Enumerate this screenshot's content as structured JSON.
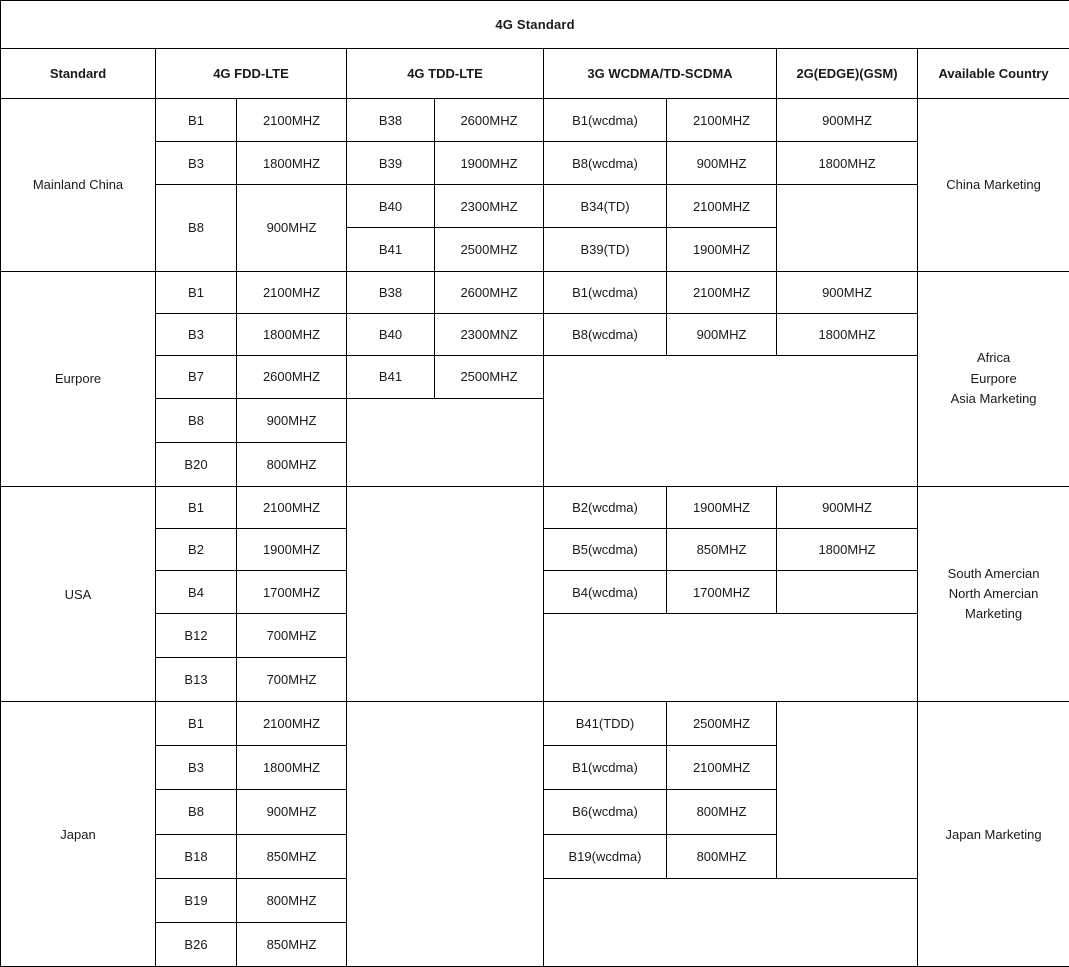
{
  "title": "4G Standard",
  "columns": {
    "standard": "Standard",
    "fdd_lte": "4G FDD-LTE",
    "tdd_lte": "4G TDD-LTE",
    "wcdma": "3G WCDMA/TD-SCDMA",
    "gsm": "2G(EDGE)(GSM)",
    "country": "Available Country"
  },
  "colors": {
    "accent": "#E8502A",
    "text": "#1a1a1a",
    "border": "#000000",
    "background": "#ffffff"
  },
  "sections": [
    {
      "name": "Mainland China",
      "market": "China Marketing",
      "fdd": [
        {
          "band": "B1",
          "freq": "2100MHZ"
        },
        {
          "band": "B3",
          "freq": "1800MHZ"
        },
        {
          "band": "B8",
          "freq": "900MHZ"
        }
      ],
      "tdd": [
        {
          "band": "B38",
          "freq": "2600MHZ"
        },
        {
          "band": "B39",
          "freq": "1900MHZ"
        },
        {
          "band": "B40",
          "freq": "2300MHZ"
        },
        {
          "band": "B41",
          "freq": "2500MHZ"
        }
      ],
      "wcdma": [
        {
          "band": "B1(wcdma)",
          "freq": "2100MHZ"
        },
        {
          "band": "B8(wcdma)",
          "freq": "900MHZ"
        },
        {
          "band": "B34(TD)",
          "freq": "2100MHZ"
        },
        {
          "band": "B39(TD)",
          "freq": "1900MHZ"
        }
      ],
      "gsm": [
        "900MHZ",
        "1800MHZ"
      ]
    },
    {
      "name": "Eurpore",
      "market": "Africa\nEurpore\nAsia Marketing",
      "market_lines": [
        "Africa",
        "Eurpore",
        "Asia Marketing"
      ],
      "fdd": [
        {
          "band": "B1",
          "freq": "2100MHZ"
        },
        {
          "band": "B3",
          "freq": "1800MHZ"
        },
        {
          "band": "B7",
          "freq": "2600MHZ"
        },
        {
          "band": "B8",
          "freq": "900MHZ"
        },
        {
          "band": "B20",
          "freq": "800MHZ"
        }
      ],
      "tdd": [
        {
          "band": "B38",
          "freq": "2600MHZ"
        },
        {
          "band": "B40",
          "freq": "2300MNZ"
        },
        {
          "band": "B41",
          "freq": "2500MHZ"
        }
      ],
      "wcdma": [
        {
          "band": "B1(wcdma)",
          "freq": "2100MHZ"
        },
        {
          "band": "B8(wcdma)",
          "freq": "900MHZ"
        }
      ],
      "gsm": [
        "900MHZ",
        "1800MHZ"
      ]
    },
    {
      "name": "USA",
      "market_lines": [
        "South Amercian",
        "North Amercian",
        "Marketing"
      ],
      "fdd": [
        {
          "band": "B1",
          "freq": "2100MHZ"
        },
        {
          "band": "B2",
          "freq": "1900MHZ"
        },
        {
          "band": "B4",
          "freq": "1700MHZ"
        },
        {
          "band": "B12",
          "freq": "700MHZ"
        },
        {
          "band": "B13",
          "freq": "700MHZ"
        }
      ],
      "tdd": [],
      "wcdma": [
        {
          "band": "B2(wcdma)",
          "freq": "1900MHZ"
        },
        {
          "band": "B5(wcdma)",
          "freq": "850MHZ"
        },
        {
          "band": "B4(wcdma)",
          "freq": "1700MHZ"
        }
      ],
      "gsm": [
        "900MHZ",
        "1800MHZ"
      ]
    },
    {
      "name": "Japan",
      "market_lines": [
        "Japan Marketing"
      ],
      "fdd": [
        {
          "band": "B1",
          "freq": "2100MHZ"
        },
        {
          "band": "B3",
          "freq": "1800MHZ"
        },
        {
          "band": "B8",
          "freq": "900MHZ"
        },
        {
          "band": "B18",
          "freq": "850MHZ"
        },
        {
          "band": "B19",
          "freq": "800MHZ"
        },
        {
          "band": "B26",
          "freq": "850MHZ"
        }
      ],
      "tdd": [],
      "wcdma": [
        {
          "band": "B41(TDD)",
          "freq": "2500MHZ"
        },
        {
          "band": "B1(wcdma)",
          "freq": "2100MHZ"
        },
        {
          "band": "B6(wcdma)",
          "freq": "800MHZ"
        },
        {
          "band": "B19(wcdma)",
          "freq": "800MHZ"
        }
      ],
      "gsm": []
    }
  ]
}
